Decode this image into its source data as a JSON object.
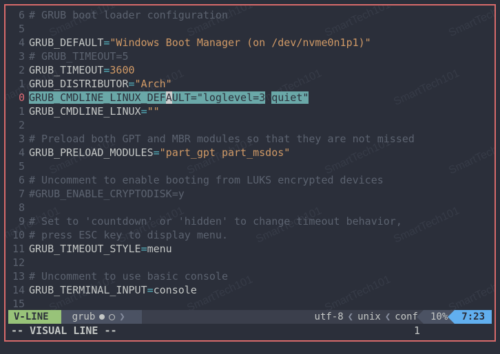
{
  "lines": [
    {
      "n": "6",
      "cur": false,
      "segments": [
        {
          "cls": "comment",
          "t": "# GRUB boot loader configuration"
        }
      ]
    },
    {
      "n": "5",
      "cur": false,
      "segments": []
    },
    {
      "n": "4",
      "cur": false,
      "segments": [
        {
          "cls": "key",
          "t": "GRUB_DEFAULT"
        },
        {
          "cls": "eq",
          "t": "="
        },
        {
          "cls": "str",
          "t": "\"Windows Boot Manager (on /dev/nvme0n1p1)\""
        }
      ]
    },
    {
      "n": "3",
      "cur": false,
      "segments": [
        {
          "cls": "comment",
          "t": "# GRUB_TIMEOUT=5"
        }
      ]
    },
    {
      "n": "2",
      "cur": false,
      "segments": [
        {
          "cls": "key",
          "t": "GRUB_TIMEOUT"
        },
        {
          "cls": "eq",
          "t": "="
        },
        {
          "cls": "num",
          "t": "3600"
        }
      ]
    },
    {
      "n": "1",
      "cur": false,
      "segments": [
        {
          "cls": "key",
          "t": "GRUB_DISTRIBUTOR"
        },
        {
          "cls": "eq",
          "t": "="
        },
        {
          "cls": "str",
          "t": "\"Arch\""
        }
      ]
    },
    {
      "n": "0",
      "cur": true,
      "segments": [
        {
          "cls": "selvar",
          "t": "GRUB_CMDLINE_LINUX_DEF"
        },
        {
          "cls": "curch",
          "t": "A"
        },
        {
          "cls": "selvar",
          "t": "ULT"
        },
        {
          "cls": "sel",
          "t": "="
        },
        {
          "cls": "sel",
          "t": "\"loglevel="
        },
        {
          "cls": "sel",
          "t": "3"
        },
        {
          "cls": "key",
          "t": " "
        },
        {
          "cls": "sel",
          "t": "quiet\""
        }
      ]
    },
    {
      "n": "1",
      "cur": false,
      "segments": [
        {
          "cls": "key",
          "t": "GRUB_CMDLINE_LINUX"
        },
        {
          "cls": "eq",
          "t": "="
        },
        {
          "cls": "str",
          "t": "\"\""
        }
      ]
    },
    {
      "n": "2",
      "cur": false,
      "segments": []
    },
    {
      "n": "3",
      "cur": false,
      "segments": [
        {
          "cls": "comment",
          "t": "# Preload both GPT and MBR modules so that they are not missed"
        }
      ]
    },
    {
      "n": "4",
      "cur": false,
      "segments": [
        {
          "cls": "key",
          "t": "GRUB_PRELOAD_MODULES"
        },
        {
          "cls": "eq",
          "t": "="
        },
        {
          "cls": "str",
          "t": "\"part_gpt part_msdos\""
        }
      ]
    },
    {
      "n": "5",
      "cur": false,
      "segments": []
    },
    {
      "n": "6",
      "cur": false,
      "segments": [
        {
          "cls": "comment",
          "t": "# Uncomment to enable booting from LUKS encrypted devices"
        }
      ]
    },
    {
      "n": "7",
      "cur": false,
      "segments": [
        {
          "cls": "comment",
          "t": "#GRUB_ENABLE_CRYPTODISK=y"
        }
      ]
    },
    {
      "n": "8",
      "cur": false,
      "segments": []
    },
    {
      "n": "9",
      "cur": false,
      "segments": [
        {
          "cls": "comment",
          "t": "# Set to 'countdown' or 'hidden' to change timeout behavior,"
        }
      ]
    },
    {
      "n": "10",
      "cur": false,
      "segments": [
        {
          "cls": "comment",
          "t": "# press ESC key to display menu."
        }
      ]
    },
    {
      "n": "11",
      "cur": false,
      "segments": [
        {
          "cls": "key",
          "t": "GRUB_TIMEOUT_STYLE"
        },
        {
          "cls": "eq",
          "t": "="
        },
        {
          "cls": "key",
          "t": "menu"
        }
      ]
    },
    {
      "n": "12",
      "cur": false,
      "segments": []
    },
    {
      "n": "13",
      "cur": false,
      "segments": [
        {
          "cls": "comment",
          "t": "# Uncomment to use basic console"
        }
      ]
    },
    {
      "n": "14",
      "cur": false,
      "segments": [
        {
          "cls": "key",
          "t": "GRUB_TERMINAL_INPUT"
        },
        {
          "cls": "eq",
          "t": "="
        },
        {
          "cls": "key",
          "t": "console"
        }
      ]
    },
    {
      "n": "15",
      "cur": false,
      "segments": []
    }
  ],
  "status": {
    "mode": "V-LINE",
    "filename": "grub",
    "encoding": "utf-8",
    "lineend": "unix",
    "filetype": "conf",
    "percent": "10%",
    "pos": "7:23"
  },
  "cmd": {
    "left": "-- VISUAL LINE --",
    "right": "1"
  },
  "watermark": "SmartTech101"
}
